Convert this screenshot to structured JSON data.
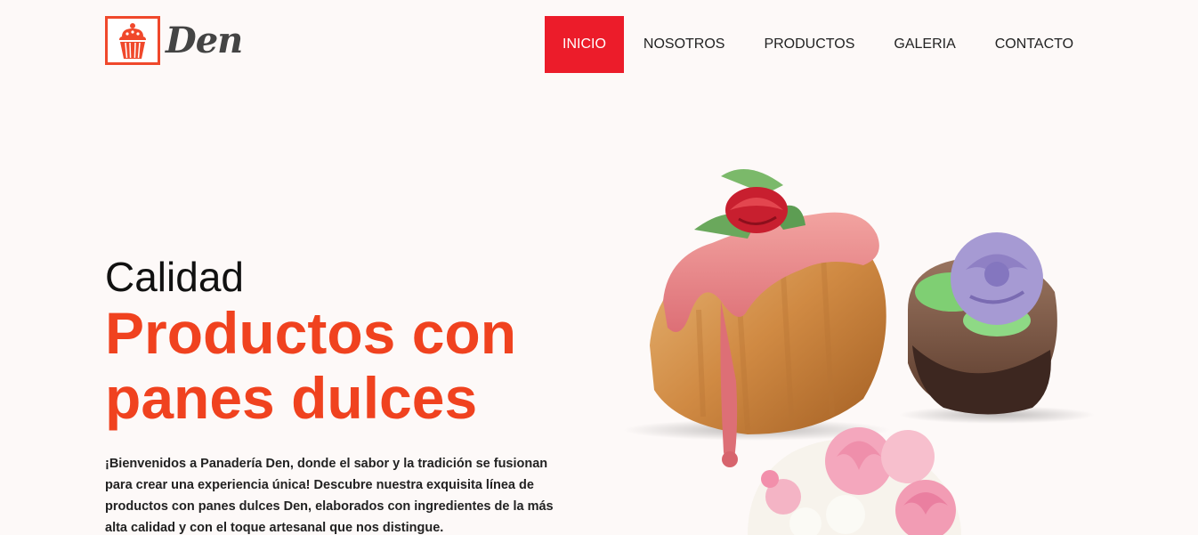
{
  "brand": {
    "name": "Den",
    "accent": "#f0482b",
    "logo_icon": "cupcake-icon"
  },
  "nav": {
    "items": [
      {
        "label": "INICIO",
        "active": true
      },
      {
        "label": "NOSOTROS",
        "active": false
      },
      {
        "label": "PRODUCTOS",
        "active": false
      },
      {
        "label": "GALERIA",
        "active": false
      },
      {
        "label": "CONTACTO",
        "active": false
      }
    ],
    "active_color": "#ec1c2a"
  },
  "hero": {
    "kicker": "Calidad",
    "title": "Productos con panes dulces",
    "description": "¡Bienvenidos a Panadería Den, donde el sabor y la tradición se fusionan para crear una experiencia única! Descubre nuestra exquisita línea de productos con panes dulces Den, elaborados con ingredientes de la más alta calidad y con el toque artesanal que nos distingue.",
    "title_color": "#f0421f",
    "image": "cupcakes-illustration"
  }
}
